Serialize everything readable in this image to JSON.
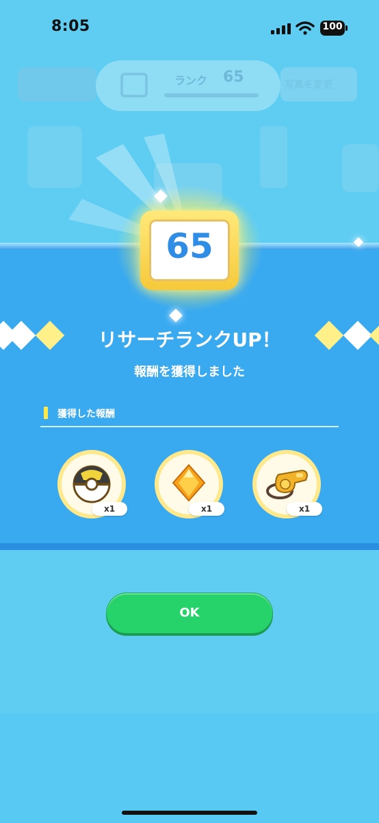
{
  "status_bar": {
    "time": "8:05",
    "battery": "100"
  },
  "background": {
    "rank_label": "ランク",
    "rank_value": "65",
    "right_tab_text": "写真を変更"
  },
  "badge": {
    "rank": "65"
  },
  "title": "リサーチランクUP！",
  "subtitle": "報酬を獲得しました",
  "rewards_section": {
    "label": "獲得した報酬",
    "items": [
      {
        "icon": "ultra-ball-icon",
        "qty": "x1"
      },
      {
        "icon": "orange-crystal-icon",
        "qty": "x1"
      },
      {
        "icon": "whistle-icon",
        "qty": "x1"
      }
    ]
  },
  "ok_button": {
    "label": "OK"
  },
  "colors": {
    "band": "#3aaaf0",
    "ok": "#26d36a",
    "rank_number": "#2f8de6",
    "sky": "#5fcdf2"
  }
}
